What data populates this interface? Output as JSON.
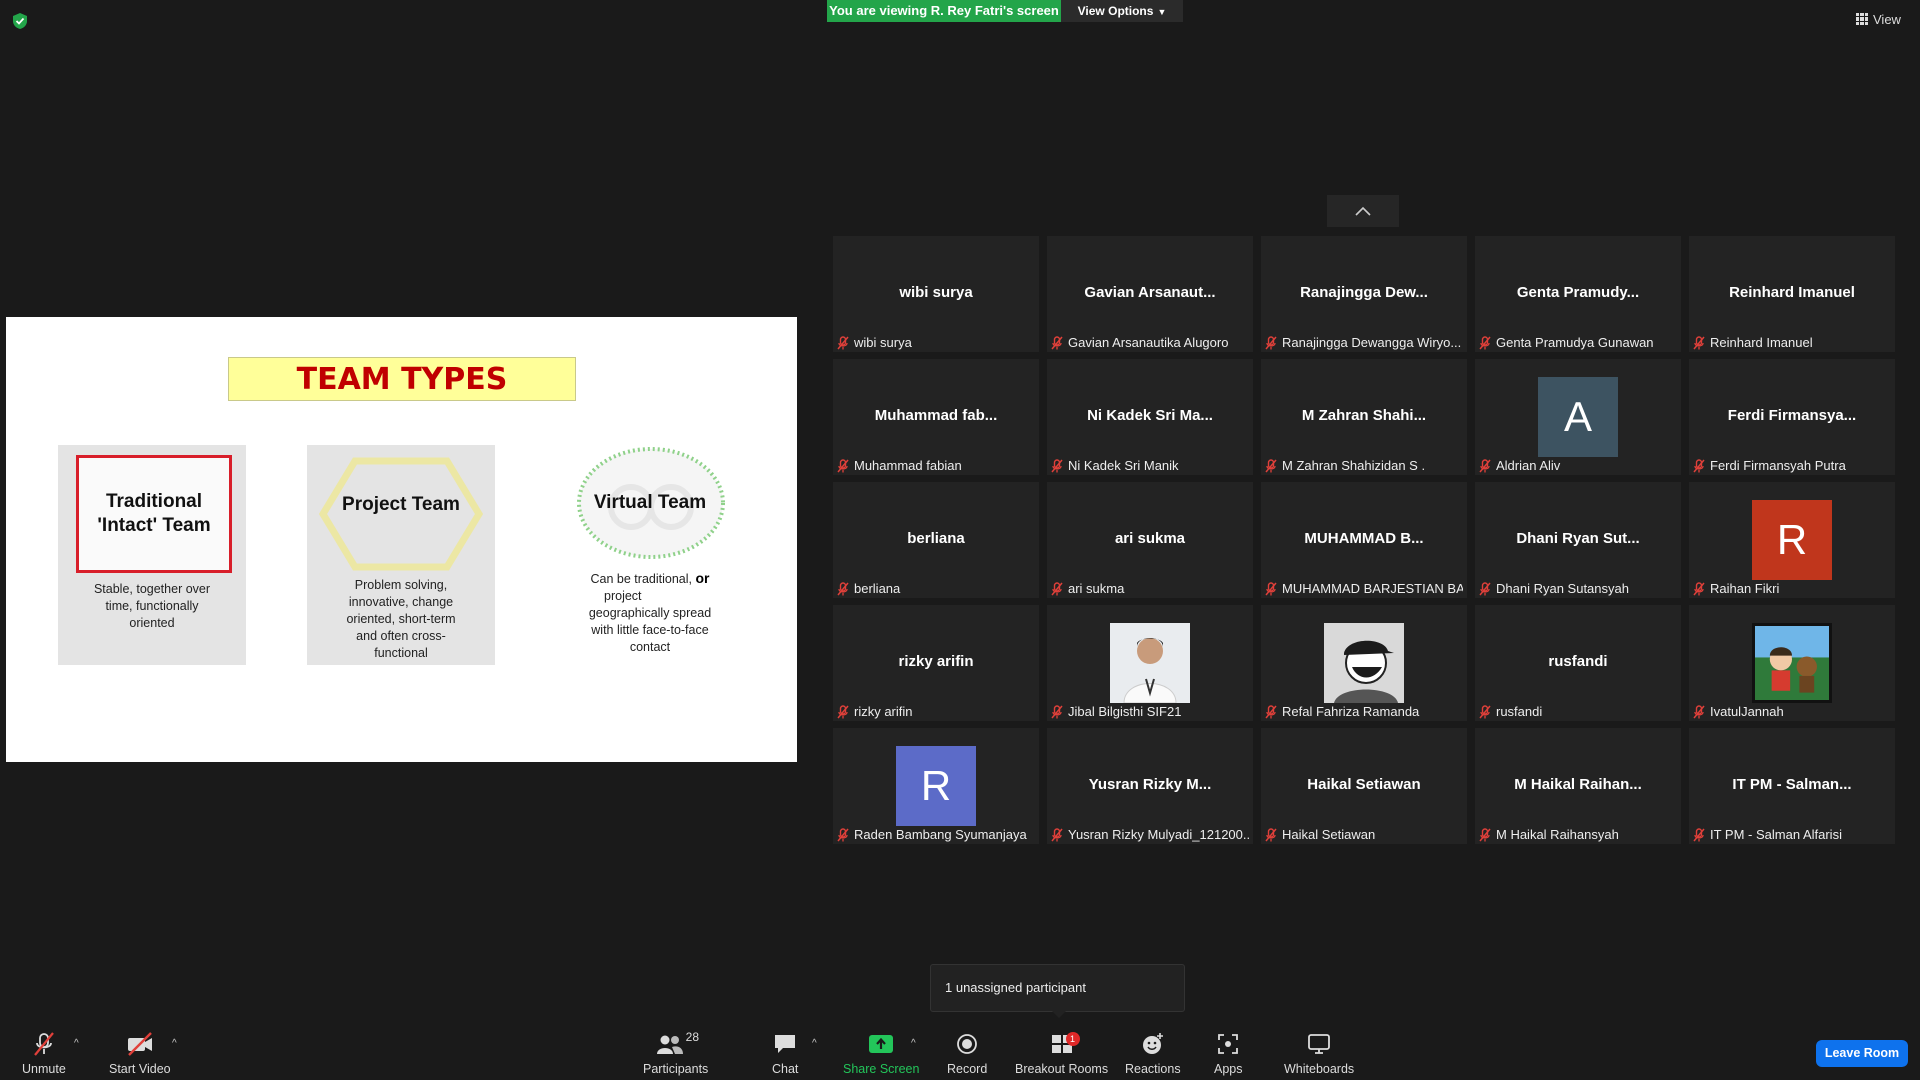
{
  "banner": {
    "viewing_text": "You are viewing R. Rey Fatri's screen",
    "view_options_label": "View Options"
  },
  "top_right": {
    "view_label": "View"
  },
  "slide": {
    "title": "TEAM TYPES",
    "cards": [
      {
        "head_line1": "Traditional",
        "head_line2": "'Intact' Team",
        "desc": [
          "Stable, together over",
          "time, functionally",
          "oriented"
        ]
      },
      {
        "head": "Project Team",
        "desc": [
          "Problem solving,",
          "innovative, change",
          "oriented, short-term",
          "and often cross-",
          "functional"
        ]
      },
      {
        "head": "Virtual Team",
        "desc_line1a": "Can be traditional, ",
        "desc_line1b": "or",
        "desc": [
          "project",
          "geographically spread",
          "with little face-to-face",
          "contact"
        ]
      }
    ]
  },
  "participants": [
    {
      "center": "wibi surya",
      "label": "wibi surya"
    },
    {
      "center": "Gavian  Arsanaut...",
      "label": "Gavian Arsanautika Alugoro"
    },
    {
      "center": "Ranajingga  Dew...",
      "label": "Ranajingga Dewangga Wiryo..."
    },
    {
      "center": "Genta  Pramudy...",
      "label": "Genta Pramudya Gunawan"
    },
    {
      "center": "Reinhard Imanuel",
      "label": "Reinhard Imanuel"
    },
    {
      "center": "Muhammad  fab...",
      "label": "Muhammad fabian"
    },
    {
      "center": "Ni  Kadek Sri Ma...",
      "label": "Ni Kadek Sri Manik"
    },
    {
      "center": "M  Zahran  Shahi...",
      "label": "M Zahran Shahizidan S ."
    },
    {
      "avatar": "A",
      "avatar_color": "#3d5361",
      "label": "Aldrian Aliv"
    },
    {
      "center": "Ferdi  Firmansya...",
      "label": "Ferdi Firmansyah Putra"
    },
    {
      "center": "berliana",
      "label": "berliana"
    },
    {
      "center": "ari sukma",
      "label": "ari sukma"
    },
    {
      "center": "MUHAMMAD  B...",
      "label": "MUHAMMAD BARJESTIAN BA..."
    },
    {
      "center": "Dhani  Ryan  Sut...",
      "label": "Dhani Ryan Sutansyah"
    },
    {
      "avatar": "R",
      "avatar_color": "#c0361c",
      "label": "Raihan Fikri"
    },
    {
      "center": "rizky arifin",
      "label": "rizky arifin"
    },
    {
      "photo": "person-photo",
      "label": "Jibal Bilgisthi SIF21"
    },
    {
      "photo": "cap-avatar",
      "label": "Refal Fahriza Ramanda"
    },
    {
      "center": "rusfandi",
      "label": "rusfandi"
    },
    {
      "photo": "cartoon-avatar",
      "label": "IvatulJannah"
    },
    {
      "avatar": "R",
      "avatar_color": "#5c6bc8",
      "label": "Raden Bambang Syumanjaya"
    },
    {
      "center": "Yusran  Rizky  M...",
      "label": "Yusran Rizky Mulyadi_121200..."
    },
    {
      "center": "Haikal Setiawan",
      "label": "Haikal Setiawan"
    },
    {
      "center": "M  Haikal  Raihan...",
      "label": "M Haikal Raihansyah"
    },
    {
      "center": "IT PM - Salman...",
      "label": "IT PM - Salman Alfarisi"
    }
  ],
  "tooltip": {
    "text": "1 unassigned participant"
  },
  "toolbar": {
    "unmute": "Unmute",
    "start_video": "Start Video",
    "participants": "Participants",
    "participants_count": "28",
    "chat": "Chat",
    "share_screen": "Share Screen",
    "record": "Record",
    "breakout_rooms": "Breakout Rooms",
    "breakout_badge": "1",
    "reactions": "Reactions",
    "apps": "Apps",
    "whiteboards": "Whiteboards",
    "leave_room": "Leave Room"
  },
  "colors": {
    "share_green": "#23a54a",
    "leave_blue": "#0e72ed",
    "muted_red": "#e0403a"
  }
}
